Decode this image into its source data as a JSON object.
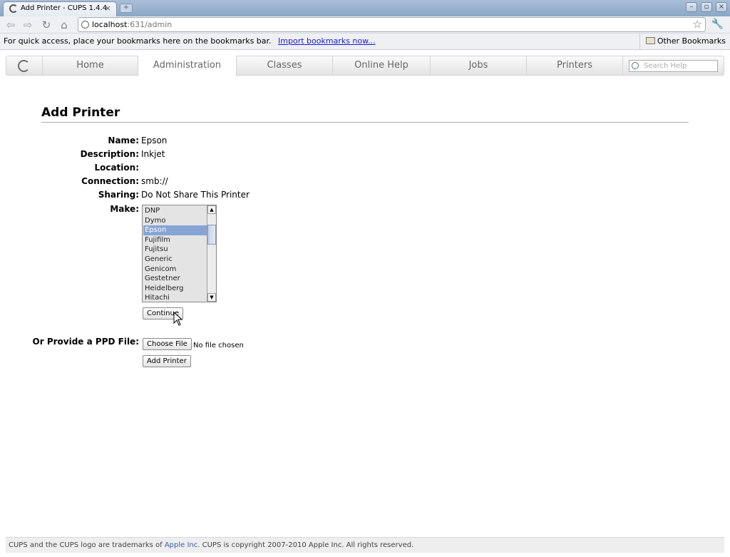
{
  "browser": {
    "tab_title": "Add Printer - CUPS 1.4.4",
    "new_tab_label": "+",
    "url_host": "localhost",
    "url_path": ":631/admin",
    "bookmarks_prompt": "For quick access, place your bookmarks here on the bookmarks bar.",
    "import_link": "Import bookmarks now...",
    "other_bookmarks": "Other Bookmarks"
  },
  "cups_nav": {
    "tabs": [
      {
        "label": "Home"
      },
      {
        "label": "Administration"
      },
      {
        "label": "Classes"
      },
      {
        "label": "Online Help"
      },
      {
        "label": "Jobs"
      },
      {
        "label": "Printers"
      }
    ],
    "search_placeholder": "Search Help"
  },
  "page": {
    "title": "Add Printer",
    "fields": {
      "name": {
        "label": "Name:",
        "value": "Epson"
      },
      "description": {
        "label": "Description:",
        "value": "Inkjet"
      },
      "location": {
        "label": "Location:",
        "value": ""
      },
      "connection": {
        "label": "Connection:",
        "value": "smb://"
      },
      "sharing": {
        "label": "Sharing:",
        "value": "Do Not Share This Printer"
      },
      "make": {
        "label": "Make:"
      }
    },
    "make_options": [
      "DNP",
      "Dymo",
      "Epson",
      "Fujifilm",
      "Fujitsu",
      "Generic",
      "Genicom",
      "Gestetner",
      "Heidelberg",
      "Hitachi"
    ],
    "make_selected": "Epson",
    "continue_button": "Continue",
    "ppd_label": "Or Provide a PPD File:",
    "choose_file_button": "Choose File",
    "no_file_text": "No file chosen",
    "add_printer_button": "Add Printer"
  },
  "footer": {
    "text_before": "CUPS and the CUPS logo are trademarks of ",
    "apple_link": "Apple Inc.",
    "text_after": " CUPS is copyright 2007-2010 Apple Inc. All rights reserved."
  }
}
